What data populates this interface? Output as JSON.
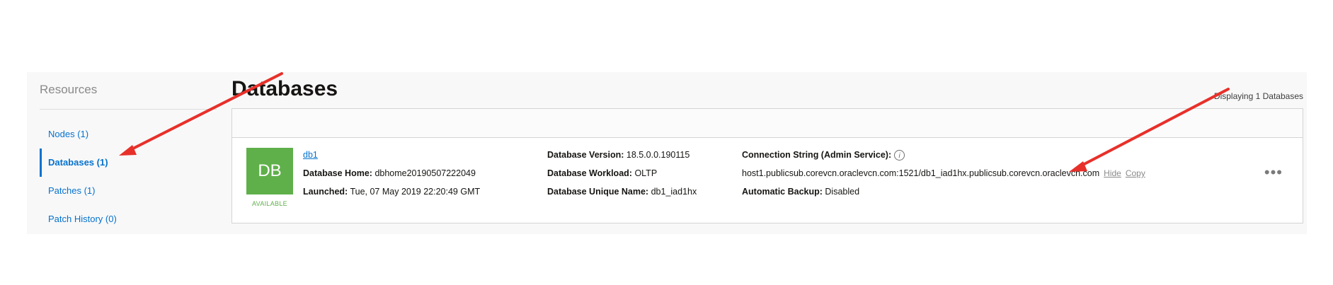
{
  "sidebar": {
    "title": "Resources",
    "items": [
      {
        "label": "Nodes (1)"
      },
      {
        "label": "Databases (1)"
      },
      {
        "label": "Patches (1)"
      },
      {
        "label": "Patch History (0)"
      }
    ]
  },
  "main": {
    "title": "Databases",
    "count_text": "Displaying 1 Databases"
  },
  "database": {
    "badge": "DB",
    "status": "AVAILABLE",
    "name": "db1",
    "home_label": "Database Home:",
    "home_value": "dbhome20190507222049",
    "launched_label": "Launched:",
    "launched_value": "Tue, 07 May 2019 22:20:49 GMT",
    "version_label": "Database Version:",
    "version_value": "18.5.0.0.190115",
    "workload_label": "Database Workload:",
    "workload_value": "OLTP",
    "unique_label": "Database Unique Name:",
    "unique_value": "db1_iad1hx",
    "conn_label": "Connection String (Admin Service):",
    "conn_value": "host1.publicsub.corevcn.oraclevcn.com:1521/db1_iad1hx.publicsub.corevcn.oraclevcn.com",
    "hide_label": "Hide",
    "copy_label": "Copy",
    "backup_label": "Automatic Backup:",
    "backup_value": "Disabled",
    "menu_label": "•••",
    "info_icon": "i"
  },
  "colors": {
    "link": "#0572ce",
    "badge": "#5fb04a",
    "annotation_arrow": "#e8302a"
  }
}
